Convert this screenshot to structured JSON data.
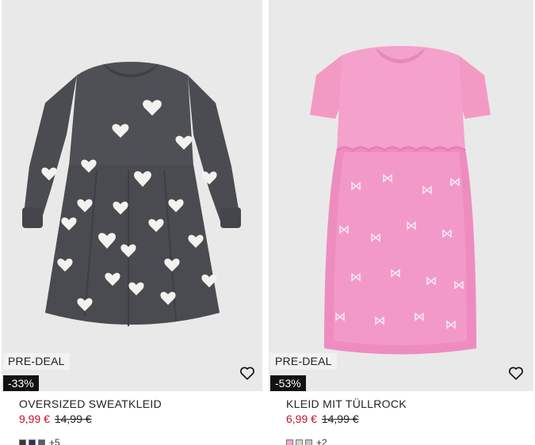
{
  "products": [
    {
      "deal_label": "PRE-DEAL",
      "discount": "-33%",
      "title": "OVERSIZED SWEATKLEID",
      "price_sale": "9,99 €",
      "price_old": "14,99 €",
      "swatch_colors": [
        "#3a3a3f",
        "#2a3550",
        "#575d6b"
      ],
      "more_colors": "+5",
      "favorite_icon": "heart-outline-icon",
      "image_alt": "dark grey dress with white hearts"
    },
    {
      "deal_label": "PRE-DEAL",
      "discount": "-53%",
      "title": "KLEID MIT TÜLLROCK",
      "price_sale": "6,99 €",
      "price_old": "14,99 €",
      "swatch_colors": [
        "#f2a9cc",
        "#d8d2cc",
        "#c9c3c0"
      ],
      "more_colors": "+2",
      "favorite_icon": "heart-outline-icon",
      "image_alt": "pink dress with tulle skirt"
    }
  ],
  "colors": {
    "sale_red": "#c8102e",
    "discount_bg": "#121212",
    "image_bg": "#e9e9e9"
  }
}
